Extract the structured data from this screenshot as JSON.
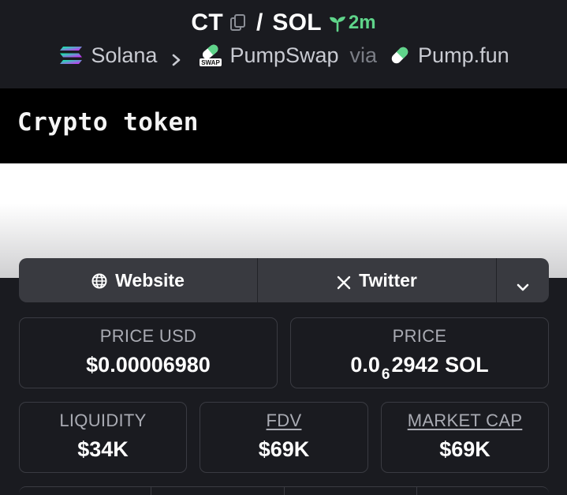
{
  "pair": {
    "base": "CT",
    "separator": "/",
    "quote": "SOL",
    "age": "2m"
  },
  "breadcrumb": {
    "chain": "Solana",
    "dex": "PumpSwap",
    "via": "via",
    "launchpad": "Pump.fun"
  },
  "banner": {
    "text": "Crypto token"
  },
  "links": {
    "website": "Website",
    "twitter": "Twitter"
  },
  "stats": {
    "price_usd": {
      "label": "PRICE USD",
      "value": "$0.00006980"
    },
    "price": {
      "label": "PRICE",
      "prefix": "0.0",
      "zeros": "6",
      "digits": "2942",
      "unit": "SOL"
    },
    "liquidity": {
      "label": "LIQUIDITY",
      "value": "$34K"
    },
    "fdv": {
      "label": "FDV",
      "value": "$69K"
    },
    "market_cap": {
      "label": "MARKET CAP",
      "value": "$69K"
    }
  },
  "colors": {
    "background": "#1a1b20",
    "accent_green": "#5fd48a",
    "card_border": "#3a3b42",
    "links_bar": "#393a40"
  }
}
